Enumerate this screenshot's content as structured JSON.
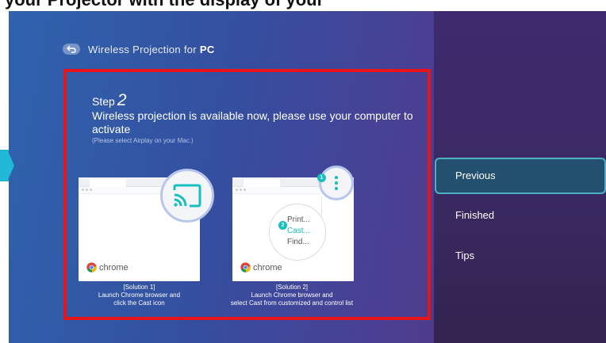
{
  "top_caption": "your Projector with the display of your",
  "header": {
    "title_prefix": "Wireless Projection for",
    "title_strong": "PC"
  },
  "step": {
    "label": "Step",
    "number": "2",
    "message": "Wireless projection is available now, please use your computer to activate",
    "note": "(Please select Airplay on your Mac.)"
  },
  "solutions": [
    {
      "logo_text": "chrome",
      "caption_lines": [
        "[Solution 1]",
        "Launch Chrome browser and",
        "click the Cast icon"
      ]
    },
    {
      "logo_text": "chrome",
      "badge_1": "1",
      "badge_2": "2",
      "menu_items": [
        "Print...",
        "Cast...",
        "Find..."
      ],
      "caption_lines": [
        "[Solution 2]",
        "Launch Chrome browser and",
        "select Cast from customized and control list"
      ]
    }
  ],
  "side_menu": {
    "previous": "Previous",
    "finished": "Finished",
    "tips": "Tips"
  },
  "colors": {
    "highlight_border": "#e8141c",
    "accent_teal": "#17bfc0",
    "selected_border": "#4fb1c4"
  }
}
